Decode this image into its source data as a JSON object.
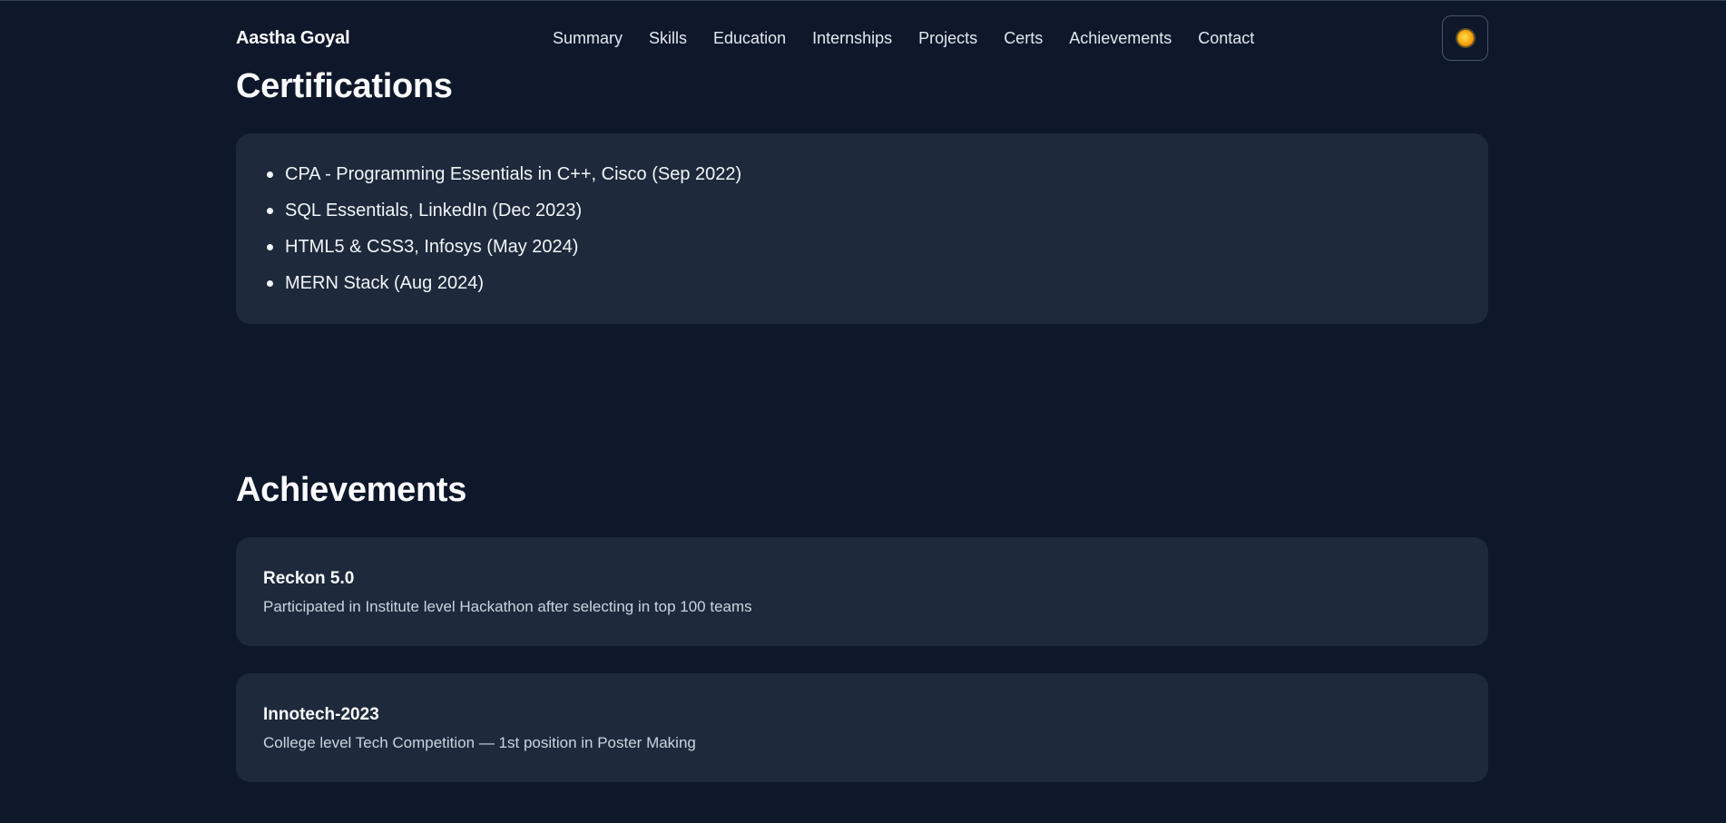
{
  "header": {
    "brand": "Aastha Goyal",
    "nav": [
      "Summary",
      "Skills",
      "Education",
      "Internships",
      "Projects",
      "Certs",
      "Achievements",
      "Contact"
    ],
    "theme_toggle_icon": "sun-icon"
  },
  "certifications": {
    "title": "Certifications",
    "items": [
      "CPA - Programming Essentials in C++, Cisco (Sep 2022)",
      "SQL Essentials, LinkedIn (Dec 2023)",
      "HTML5 & CSS3, Infosys (May 2024)",
      "MERN Stack (Aug 2024)"
    ]
  },
  "achievements": {
    "title": "Achievements",
    "items": [
      {
        "title": "Reckon 5.0",
        "description": "Participated in Institute level Hackathon after selecting in top 100 teams"
      },
      {
        "title": "Innotech-2023",
        "description": "College level Tech Competition — 1st position in Poster Making"
      }
    ]
  },
  "colors": {
    "background": "#0f172a",
    "card": "#1e293b",
    "accent_sun": "#f59e0b"
  }
}
